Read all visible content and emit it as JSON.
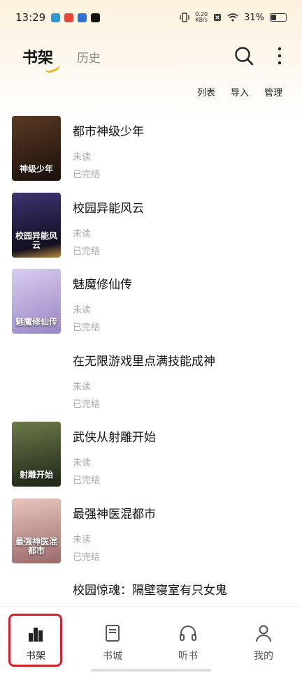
{
  "status_bar": {
    "time": "13:29",
    "net_speed_value": "0.20",
    "net_speed_unit": "KB/s",
    "battery": "31%"
  },
  "header": {
    "tab_active": "书架",
    "tab_inactive": "历史"
  },
  "actions": {
    "list": "列表",
    "import": "导入",
    "manage": "管理"
  },
  "books": [
    {
      "title": "都市神级少年",
      "progress": "未读",
      "status": "已完结",
      "cover_text": "神级少年",
      "cover_color": "#3a2417"
    },
    {
      "title": "校园异能风云",
      "progress": "未读",
      "status": "已完结",
      "cover_text": "校园异能风云",
      "cover_color": "#2a2140"
    },
    {
      "title": "魅魔修仙传",
      "progress": "未读",
      "status": "已完结",
      "cover_text": "魅魔修仙传",
      "cover_color": "#b8a9d8"
    },
    {
      "title": "在无限游戏里点满技能成神",
      "progress": "未读",
      "status": "已完结",
      "cover_text": "",
      "cover_color": "#ffffff"
    },
    {
      "title": "武侠从射雕开始",
      "progress": "未读",
      "status": "已完结",
      "cover_text": "射雕开始",
      "cover_color": "#3c4a2e"
    },
    {
      "title": "最强神医混都市",
      "progress": "未读",
      "status": "已完结",
      "cover_text": "最强神医混都市",
      "cover_color": "#d8a8a0"
    },
    {
      "title": "校园惊魂：隔壁寝室有只女鬼",
      "progress": "",
      "status": "",
      "cover_text": "",
      "cover_color": "#ffffff"
    }
  ],
  "bottom_nav": [
    {
      "label": "书架",
      "icon": "bar-chart-icon",
      "active": true
    },
    {
      "label": "书城",
      "icon": "book-icon",
      "active": false
    },
    {
      "label": "听书",
      "icon": "headphones-icon",
      "active": false
    },
    {
      "label": "我的",
      "icon": "person-icon",
      "active": false
    }
  ],
  "colors": {
    "accent": "#f0b323",
    "highlight": "#d61f26"
  }
}
